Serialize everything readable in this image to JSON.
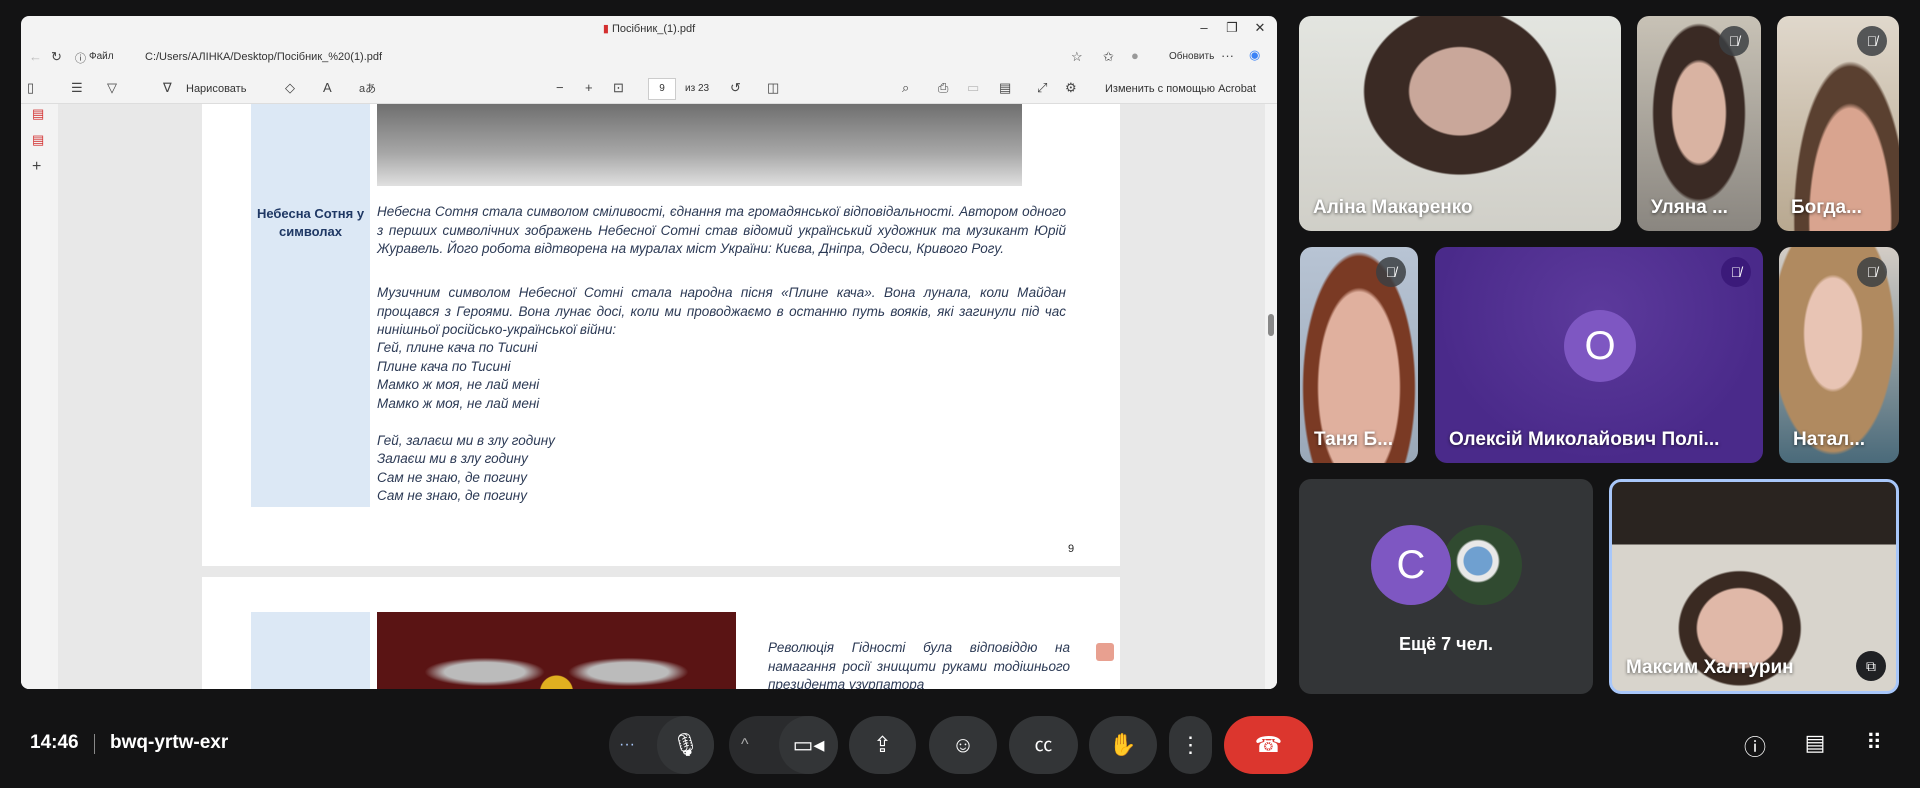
{
  "pdf_window": {
    "title": "Посібник_(1).pdf",
    "file_label": "Файл",
    "address": "C:/Users/АЛІНКА/Desktop/Посібник_%20(1).pdf",
    "update_button": "Обновить",
    "draw_label": "Нарисовать",
    "page_current": "9",
    "page_total": "из 23",
    "edit_acrobat": "Изменить с помощью Acrobat"
  },
  "document": {
    "page9": {
      "row_heading": "Небесна Сотня у символах",
      "paragraph1": "Небесна Сотня стала символом сміливості, єднання та громадянської відповідальності. Автором одного з перших символічних зображень Небесної Сотні став відомий український художник та музикант Юрій Журавель. Його робота відтворена на муралах міст України: Києва, Дніпра, Одеси, Кривого Рогу.",
      "paragraph2": "Музичним символом Небесної Сотні стала народна пісня «Плине кача». Вона лунала, коли Майдан прощався з Героями. Вона лунає досі, коли ми проводжаємо в останню путь вояків, які загинули під час нинішньої російсько-української війни:",
      "lyrics": [
        "Гей, плине кача по Тисині",
        "Плине кача по Тисині",
        "Мамко ж моя, не лай мені",
        "Мамко ж моя, не лай мені",
        "",
        "Гей, залаєш ми в злу годину",
        "Залаєш ми в злу годину",
        "Сам не знаю, де погину",
        "Сам не знаю, де погину"
      ],
      "page_number": "9"
    },
    "page10": {
      "paragraph": "Революція Гідності була відповіддю на намагання росії знищити руками тодішнього президента узурпатора"
    }
  },
  "participants": [
    {
      "name": "Аліна Макаренко",
      "muted": false
    },
    {
      "name": "Уляна ...",
      "muted": true
    },
    {
      "name": "Богда...",
      "muted": true
    },
    {
      "name": "Таня Б...",
      "muted": true
    },
    {
      "name": "Олексій Миколайович Полі...",
      "muted": true,
      "avatar_letter": "О",
      "tile_color": "#4a2a8a"
    },
    {
      "name": "Натал...",
      "muted": true
    },
    {
      "name": "Максим Халтурин",
      "muted": false
    }
  ],
  "others": {
    "avatar_letter": "С",
    "label": "Ещё 7 чел."
  },
  "meeting": {
    "time": "14:46",
    "code": "bwq-yrtw-exr"
  },
  "colors": {
    "end_call": "#dc362e",
    "avatar": "#7e57c2",
    "control_bg": "#333537"
  }
}
